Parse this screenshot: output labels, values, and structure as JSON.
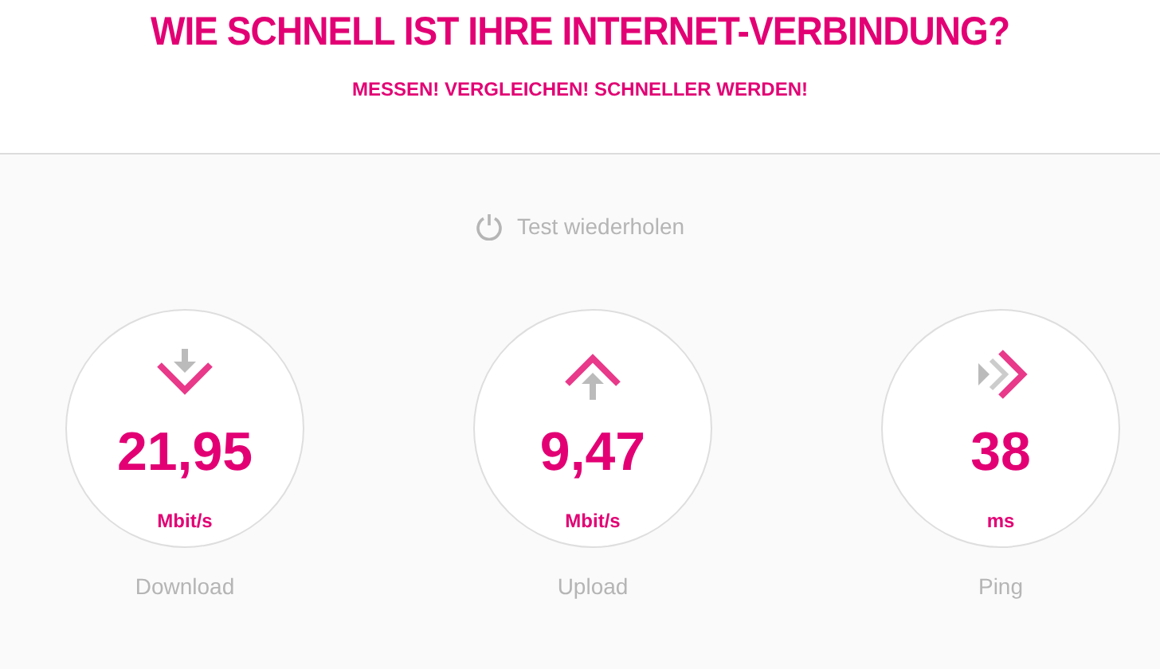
{
  "header": {
    "title": "WIE SCHNELL IST IHRE INTERNET-VERBINDUNG?",
    "subtitle": "MESSEN! VERGLEICHEN! SCHNELLER WERDEN!"
  },
  "repeat_button": {
    "label": "Test wiederholen"
  },
  "results": [
    {
      "kind": "download",
      "value": "21,95",
      "unit": "Mbit/s",
      "label": "Download"
    },
    {
      "kind": "upload",
      "value": "9,47",
      "unit": "Mbit/s",
      "label": "Upload"
    },
    {
      "kind": "ping",
      "value": "38",
      "unit": "ms",
      "label": "Ping"
    }
  ]
}
